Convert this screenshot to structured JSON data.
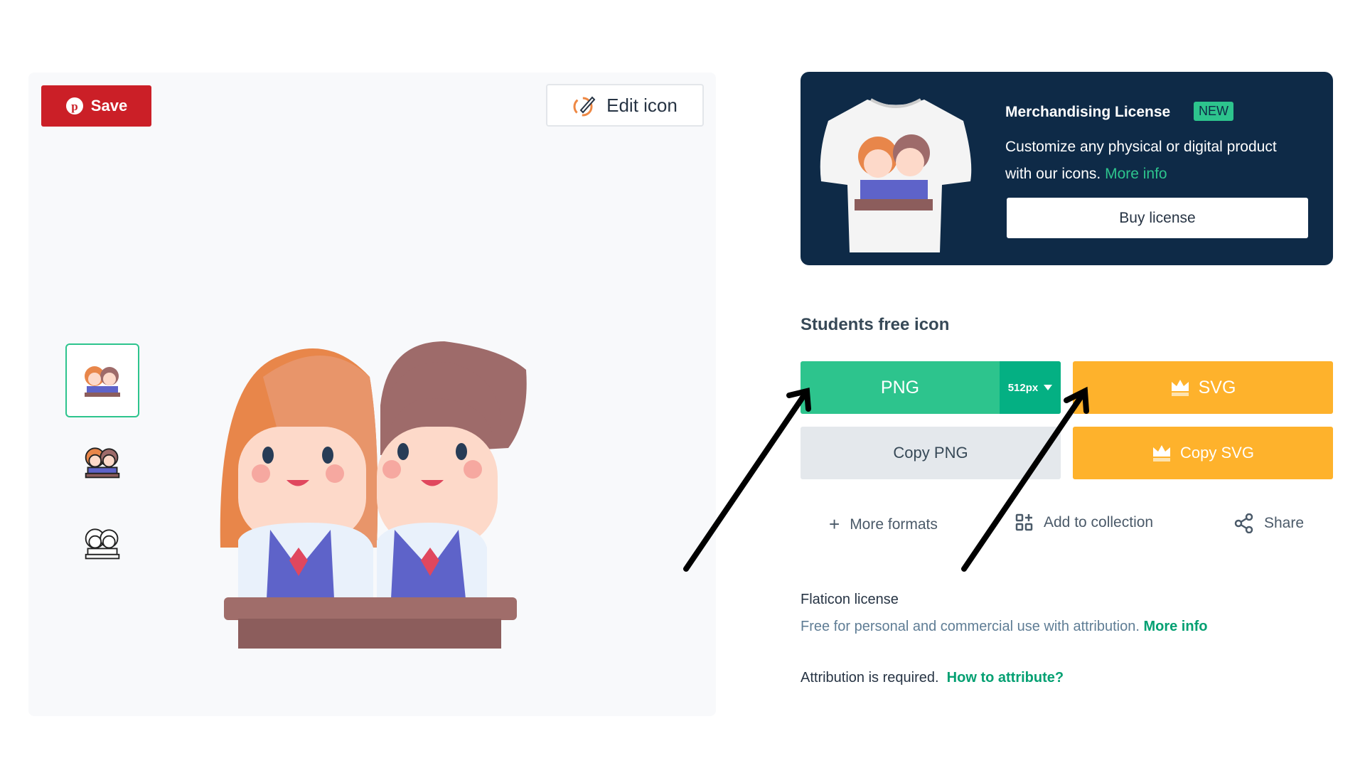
{
  "preview": {
    "save_label": "Save",
    "edit_label": "Edit icon",
    "thumbnails": [
      "color",
      "lineal-color",
      "lineal"
    ]
  },
  "banner": {
    "title": "Merchandising License",
    "badge": "NEW",
    "description": "Customize any physical or digital product with our icons.",
    "more_info": "More info",
    "buy_label": "Buy license"
  },
  "icon": {
    "title": "Students free icon"
  },
  "download": {
    "png_label": "PNG",
    "size": "512px",
    "svg_label": "SVG",
    "copy_png": "Copy PNG",
    "copy_svg": "Copy SVG"
  },
  "actions": {
    "more_formats": "More formats",
    "add_collection": "Add to collection",
    "share": "Share"
  },
  "license": {
    "title": "Flaticon license",
    "description": "Free for personal and commercial use with attribution.",
    "more_info": "More info",
    "attribution": "Attribution is required.",
    "how_to": "How to attribute?"
  },
  "colors": {
    "green": "#2dc48d",
    "orange": "#feb22c",
    "navy": "#0e2a47",
    "pinterest": "#cb1f27"
  }
}
